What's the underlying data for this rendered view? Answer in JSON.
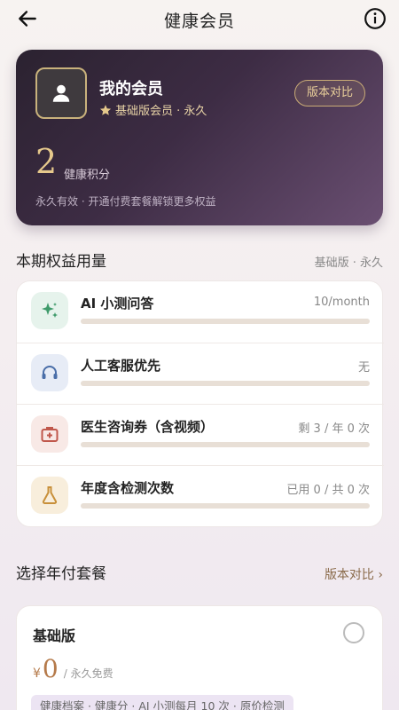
{
  "header": {
    "title": "健康会员"
  },
  "member": {
    "title": "我的会员",
    "level": "基础版会员 · 永久",
    "compare_label": "版本对比",
    "points_value": "2",
    "points_label": "健康积分",
    "note": "永久有效 · 开通付费套餐解锁更多权益"
  },
  "usage_section": {
    "title": "本期权益用量",
    "plan_tag": "基础版 · 永久",
    "items": [
      {
        "name": "AI 小测问答",
        "value": "10/month",
        "fill": 0,
        "icon": "sparkle-icon"
      },
      {
        "name": "人工客服优先",
        "value": "无",
        "fill": 0,
        "icon": "headset-icon"
      },
      {
        "name": "医生咨询券（含视频）",
        "value": "剩 3 / 年 0 次",
        "fill": 0,
        "icon": "medical-kit-icon"
      },
      {
        "name": "年度含检测次数",
        "value": "已用 0 / 共 0 次",
        "fill": 0,
        "icon": "flask-icon"
      }
    ]
  },
  "plans_section": {
    "title": "选择年付套餐",
    "compare_link": "版本对比 ›",
    "plan": {
      "name": "基础版",
      "currency": "¥",
      "price": "0",
      "period": "/ 永久免费",
      "features": "健康档案 · 健康分 · AI 小测每月 10 次 · 原价检测"
    }
  },
  "colors": {
    "accent_gold": "#c9ab76",
    "card_dark": "#2b2230",
    "price": "#b57a4a"
  }
}
